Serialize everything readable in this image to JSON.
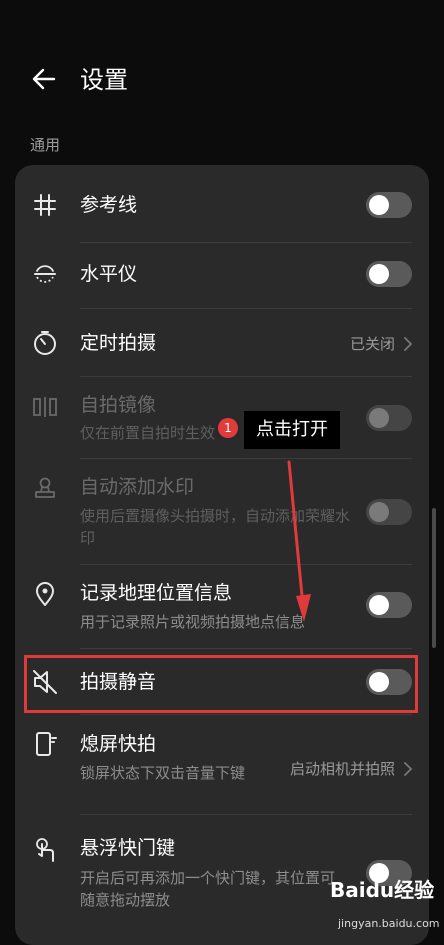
{
  "header": {
    "title": "设置"
  },
  "section": {
    "label": "通用"
  },
  "rows": [
    {
      "title": "参考线",
      "icon": "grid-icon"
    },
    {
      "title": "水平仪",
      "icon": "level-icon"
    },
    {
      "title": "定时拍摄",
      "value": "已关闭",
      "icon": "timer-icon"
    },
    {
      "title": "自拍镜像",
      "subtitle": "仅在前置自拍时生效",
      "icon": "mirror-icon"
    },
    {
      "title": "自动添加水印",
      "subtitle": "使用后置摄像头拍摄时，自动添加荣耀水印",
      "icon": "stamp-icon"
    },
    {
      "title": "记录地理位置信息",
      "subtitle": "用于记录照片或视频拍摄地点信息",
      "icon": "location-icon"
    },
    {
      "title": "拍摄静音",
      "icon": "mute-icon"
    },
    {
      "title": "熄屏快拍",
      "subtitle": "锁屏状态下双击音量下键",
      "value": "启动相机并拍照",
      "icon": "phone-icon"
    },
    {
      "title": "悬浮快门键",
      "subtitle": "开启后可再添加一个快门键，其位置可随意拖动摆放",
      "icon": "touch-icon"
    }
  ],
  "annotation": {
    "badge": "1",
    "text": "点击打开"
  },
  "watermark": {
    "brand": "Baidu经验",
    "url": "jingyan.baidu.com"
  },
  "colors": {
    "highlight": "#e03a3a",
    "card": "#2a2a2a",
    "background": "#0c0c0c"
  }
}
